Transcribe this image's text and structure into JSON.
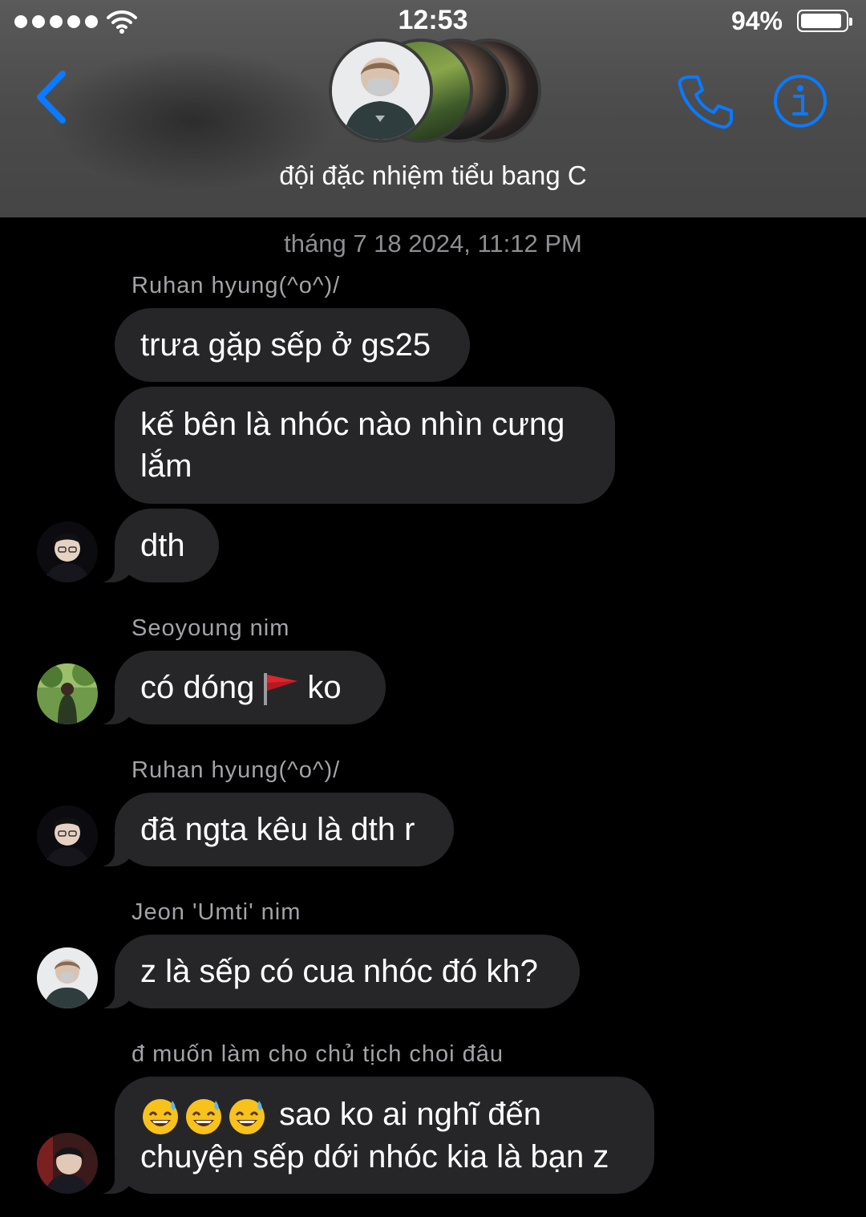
{
  "status_bar": {
    "time": "12:53",
    "battery": "94%",
    "signal_bars": 5
  },
  "header": {
    "group_name": "đội đặc nhiệm tiểu bang C",
    "accent_color": "#0a7aff"
  },
  "chat": {
    "timestamp": "tháng 7 18 2024, 11:12 PM",
    "groups": [
      {
        "sender": "Ruhan hyung(^o^)/",
        "messages": [
          "trưa gặp sếp ở gs25",
          "kế bên là nhóc nào nhìn cưng lắm",
          "dth"
        ]
      },
      {
        "sender": "Seoyoung nim",
        "messages": [
          {
            "before": "có dóng",
            "emoji": "red-flag",
            "after": "ko"
          }
        ]
      },
      {
        "sender": "Ruhan hyung(^o^)/",
        "messages": [
          "đã ngta kêu là dth r"
        ]
      },
      {
        "sender": "Jeon 'Umti' nim",
        "messages": [
          "z là sếp có cua nhóc đó kh?"
        ]
      },
      {
        "sender": "đ muốn làm cho chủ tịch choi đâu",
        "messages": [
          {
            "emoji": "sweat-smile x3",
            "line1": "sao ko ai nghĩ đến",
            "line2": "chuyện sếp dới nhóc kia là bạn z"
          }
        ]
      }
    ]
  }
}
